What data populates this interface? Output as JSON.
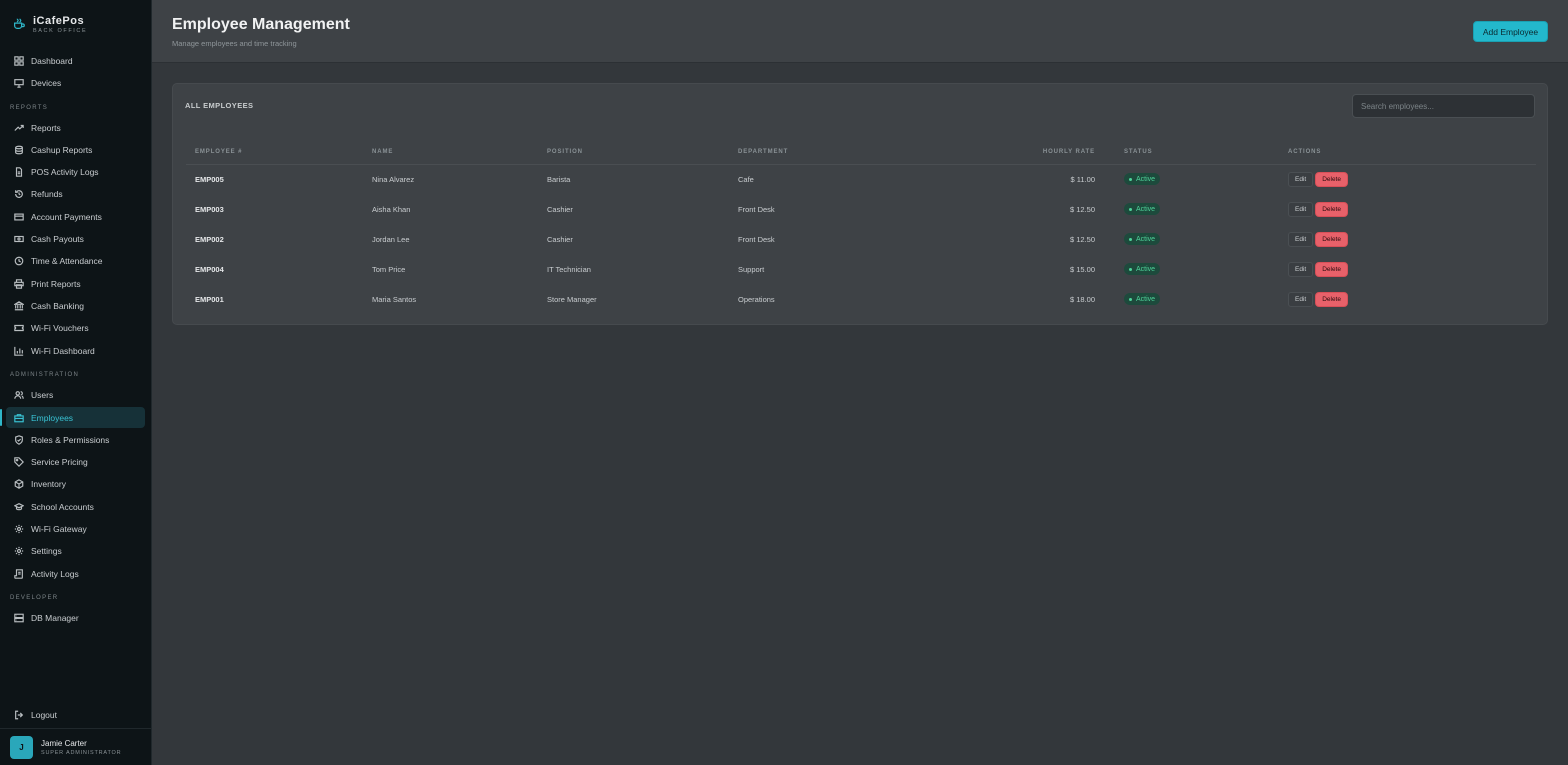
{
  "brand": {
    "name": "iCafePos",
    "subtitle": "BACK OFFICE"
  },
  "sidebar": {
    "items": [
      {
        "label": "Dashboard"
      },
      {
        "label": "Devices"
      },
      {
        "label": "Reports"
      },
      {
        "label": "Cashup Reports"
      },
      {
        "label": "POS Activity Logs"
      },
      {
        "label": "Refunds"
      },
      {
        "label": "Account Payments"
      },
      {
        "label": "Cash Payouts"
      },
      {
        "label": "Time & Attendance"
      },
      {
        "label": "Print Reports"
      },
      {
        "label": "Cash Banking"
      },
      {
        "label": "Wi-Fi Vouchers"
      },
      {
        "label": "Wi-Fi Dashboard"
      },
      {
        "label": "Users"
      },
      {
        "label": "Employees"
      },
      {
        "label": "Roles & Permissions"
      },
      {
        "label": "Service Pricing"
      },
      {
        "label": "Inventory"
      },
      {
        "label": "School Accounts"
      },
      {
        "label": "Wi-Fi Gateway"
      },
      {
        "label": "Settings"
      },
      {
        "label": "Activity Logs"
      },
      {
        "label": "DB Manager"
      }
    ],
    "sections": {
      "reports": "REPORTS",
      "administration": "ADMINISTRATION",
      "developer": "DEVELOPER"
    },
    "logout": "Logout",
    "user": {
      "initial": "J",
      "name": "Jamie Carter",
      "role": "SUPER ADMINISTRATOR"
    }
  },
  "header": {
    "title": "Employee Management",
    "subtitle": "Manage employees and time tracking",
    "add_button": "Add Employee"
  },
  "card": {
    "title": "ALL EMPLOYEES",
    "search_placeholder": "Search employees..."
  },
  "table": {
    "columns": [
      "EMPLOYEE #",
      "NAME",
      "POSITION",
      "DEPARTMENT",
      "HOURLY RATE",
      "STATUS",
      "ACTIONS"
    ],
    "rows": [
      {
        "id": "EMP005",
        "name": "Nina Alvarez",
        "position": "Barista",
        "department": "Cafe",
        "rate": "$ 11.00",
        "status": "Active"
      },
      {
        "id": "EMP003",
        "name": "Aisha Khan",
        "position": "Cashier",
        "department": "Front Desk",
        "rate": "$ 12.50",
        "status": "Active"
      },
      {
        "id": "EMP002",
        "name": "Jordan Lee",
        "position": "Cashier",
        "department": "Front Desk",
        "rate": "$ 12.50",
        "status": "Active"
      },
      {
        "id": "EMP004",
        "name": "Tom Price",
        "position": "IT Technician",
        "department": "Support",
        "rate": "$ 15.00",
        "status": "Active"
      },
      {
        "id": "EMP001",
        "name": "Maria Santos",
        "position": "Store Manager",
        "department": "Operations",
        "rate": "$ 18.00",
        "status": "Active"
      }
    ],
    "edit_label": "Edit",
    "delete_label": "Delete"
  },
  "colors": {
    "accent": "#23b8cc",
    "danger": "#e8616a",
    "success": "#4ed49a"
  }
}
